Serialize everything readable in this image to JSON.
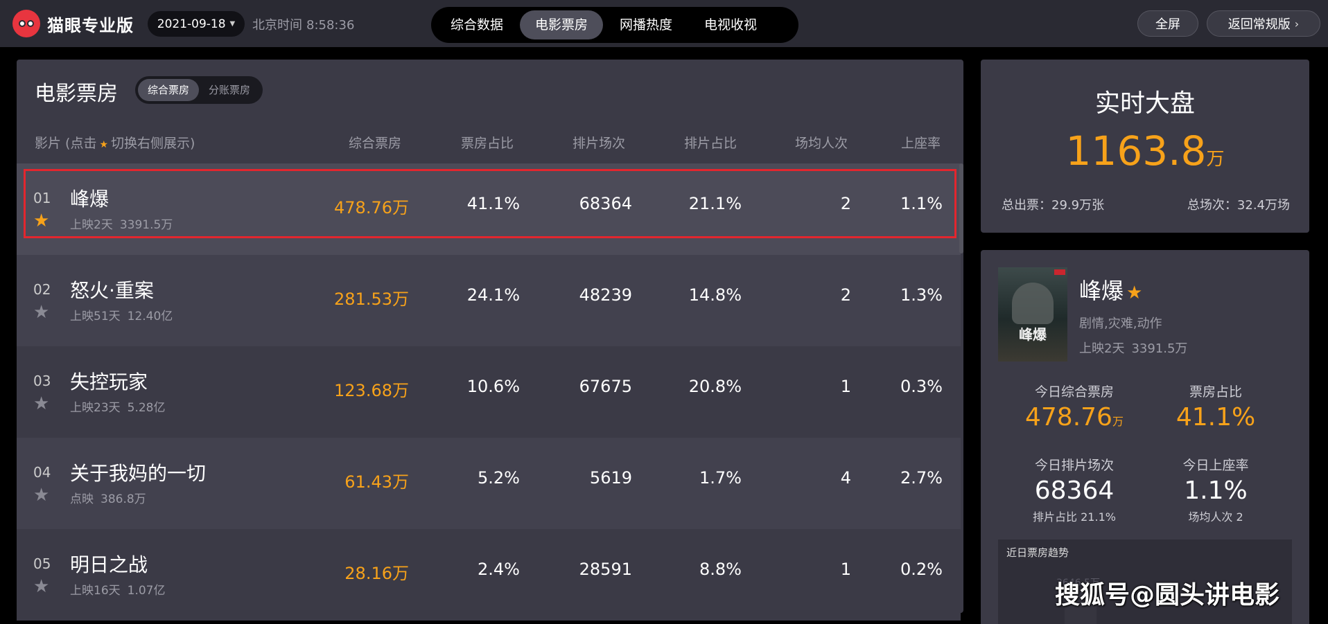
{
  "app": {
    "logo_text": "猫眼专业版"
  },
  "header": {
    "date": "2021-09-18",
    "clock_label": "北京时间",
    "clock_time": "8:58:36",
    "nav": [
      "综合数据",
      "电影票房",
      "网播热度",
      "电视收视"
    ],
    "nav_active": "电影票房",
    "fullscreen_label": "全屏",
    "back_label": "返回常规版"
  },
  "left_panel": {
    "title": "电影票房",
    "toggle": [
      "综合票房",
      "分账票房"
    ],
    "toggle_active": "综合票房",
    "columns": {
      "film_prefix": "影片 (点击",
      "film_suffix": "切换右侧展示)",
      "box_office": "综合票房",
      "share": "票房占比",
      "shows": "排片场次",
      "show_share": "排片占比",
      "avg_viewers": "场均人次",
      "occupancy": "上座率"
    },
    "rows": [
      {
        "rank": "01",
        "name": "峰爆",
        "days": "上映2天",
        "total": "3391.5万",
        "box_office": "478.76万",
        "share": "41.1%",
        "shows": "68364",
        "show_share": "21.1%",
        "avg_viewers": "2",
        "occupancy": "1.1%",
        "starred": true
      },
      {
        "rank": "02",
        "name": "怒火·重案",
        "days": "上映51天",
        "total": "12.40亿",
        "box_office": "281.53万",
        "share": "24.1%",
        "shows": "48239",
        "show_share": "14.8%",
        "avg_viewers": "2",
        "occupancy": "1.3%",
        "starred": false
      },
      {
        "rank": "03",
        "name": "失控玩家",
        "days": "上映23天",
        "total": "5.28亿",
        "box_office": "123.68万",
        "share": "10.6%",
        "shows": "67675",
        "show_share": "20.8%",
        "avg_viewers": "1",
        "occupancy": "0.3%",
        "starred": false
      },
      {
        "rank": "04",
        "name": "关于我妈的一切",
        "days": "点映",
        "total": "386.8万",
        "box_office": "61.43万",
        "share": "5.2%",
        "shows": "5619",
        "show_share": "1.7%",
        "avg_viewers": "4",
        "occupancy": "2.7%",
        "starred": false
      },
      {
        "rank": "05",
        "name": "明日之战",
        "days": "上映16天",
        "total": "1.07亿",
        "box_office": "28.16万",
        "share": "2.4%",
        "shows": "28591",
        "show_share": "8.8%",
        "avg_viewers": "1",
        "occupancy": "0.2%",
        "starred": false
      }
    ]
  },
  "realtime": {
    "title": "实时大盘",
    "value": "1163.8",
    "unit": "万",
    "tickets": "总出票：29.9万张",
    "shows": "总场次：32.4万场"
  },
  "detail": {
    "poster_text": "峰爆",
    "name": "峰爆",
    "genre": "剧情,灾难,动作",
    "days": "上映2天",
    "total": "3391.5万",
    "today_bo_label": "今日综合票房",
    "today_bo_value": "478.76",
    "today_bo_unit": "万",
    "share_label": "票房占比",
    "share_value": "41.1%",
    "shows_label": "今日排片场次",
    "shows_value": "68364",
    "show_share_note": "排片占比 21.1%",
    "occupancy_label": "今日上座率",
    "occupancy_value": "1.1%",
    "avg_note": "场均人次 2",
    "trend_title": "近日票房趋势",
    "trend_peek": "3646.5万"
  },
  "watermark": "搜狐号@圆头讲电影",
  "colors": {
    "accent": "#f7a21a",
    "highlight_border": "#e3262e",
    "panel": "#3b3a46",
    "topbar": "#2a2a33"
  }
}
